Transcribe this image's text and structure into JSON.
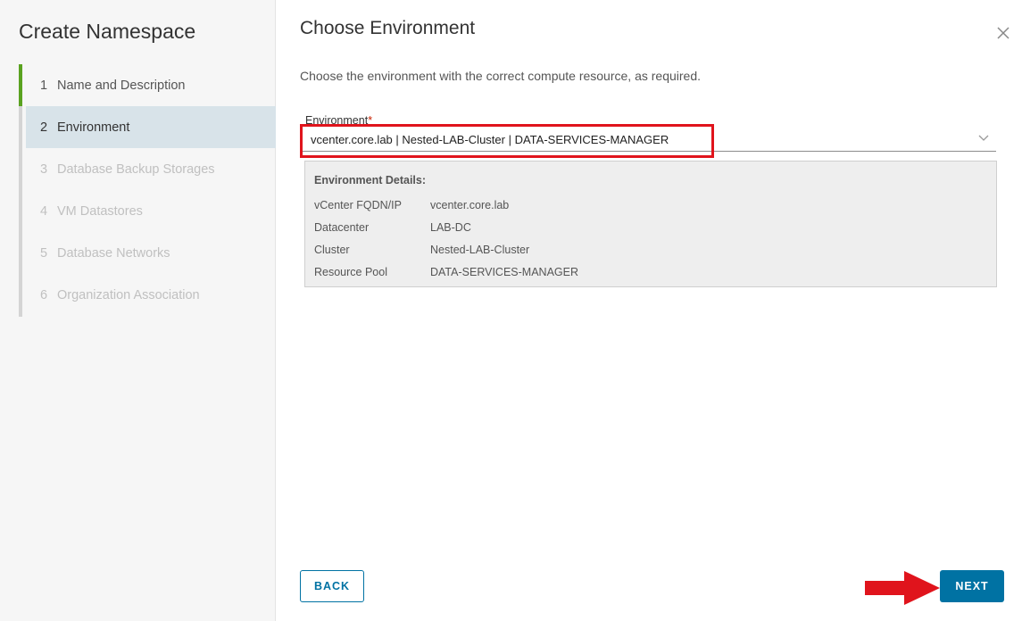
{
  "sidebar": {
    "title": "Create Namespace",
    "steps": [
      {
        "num": "1",
        "label": "Name and Description"
      },
      {
        "num": "2",
        "label": "Environment"
      },
      {
        "num": "3",
        "label": "Database Backup Storages"
      },
      {
        "num": "4",
        "label": "VM Datastores"
      },
      {
        "num": "5",
        "label": "Database Networks"
      },
      {
        "num": "6",
        "label": "Organization Association"
      }
    ]
  },
  "main": {
    "title": "Choose Environment",
    "subtitle": "Choose the environment with the correct compute resource, as required.",
    "environment": {
      "label": "Environment",
      "required_mark": "*",
      "value": "vcenter.core.lab | Nested-LAB-Cluster | DATA-SERVICES-MANAGER"
    },
    "details": {
      "heading": "Environment Details:",
      "rows": [
        {
          "key": "vCenter FQDN/IP",
          "value": "vcenter.core.lab"
        },
        {
          "key": "Datacenter",
          "value": "LAB-DC"
        },
        {
          "key": "Cluster",
          "value": "Nested-LAB-Cluster"
        },
        {
          "key": "Resource Pool",
          "value": "DATA-SERVICES-MANAGER"
        }
      ]
    }
  },
  "footer": {
    "back_label": "BACK",
    "next_label": "NEXT"
  },
  "colors": {
    "accent": "#0072a3",
    "step_done": "#5aa220",
    "highlight": "#e0141c"
  },
  "icons": {
    "close": "close-icon",
    "dropdown": "chevron-down-icon",
    "annotation": "arrow-right-icon"
  }
}
